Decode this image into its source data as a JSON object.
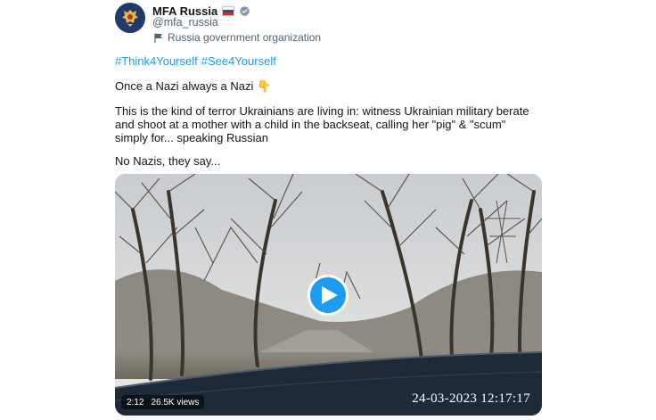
{
  "author": {
    "display_name": "MFA Russia",
    "flag_emoji": "flag-russia",
    "verified_icon": "verified-badge-icon",
    "handle": "@mfa_russia",
    "affiliation": "Russia government organization",
    "avatar": "russian-coat-of-arms"
  },
  "tweet": {
    "hashtags": [
      "#Think4Yourself",
      "#See4Yourself"
    ],
    "paragraph_1": "Once a Nazi always a Nazi",
    "paragraph_1_emoji": "👇",
    "paragraph_2": "This is the kind of terror Ukrainians are living in: witness Ukrainian military berate and shoot at a mother with a child in the backseat, calling her \"pig\" & \"scum\" simply for... speaking Russian",
    "paragraph_3": "No Nazis, they say..."
  },
  "video": {
    "duration": "2:12",
    "views": "26.5K views",
    "overlay_timestamp": "24-03-2023 12:17:17"
  },
  "colors": {
    "link": "#1d9bf0",
    "text": "#0f1419",
    "secondary": "#536471"
  }
}
